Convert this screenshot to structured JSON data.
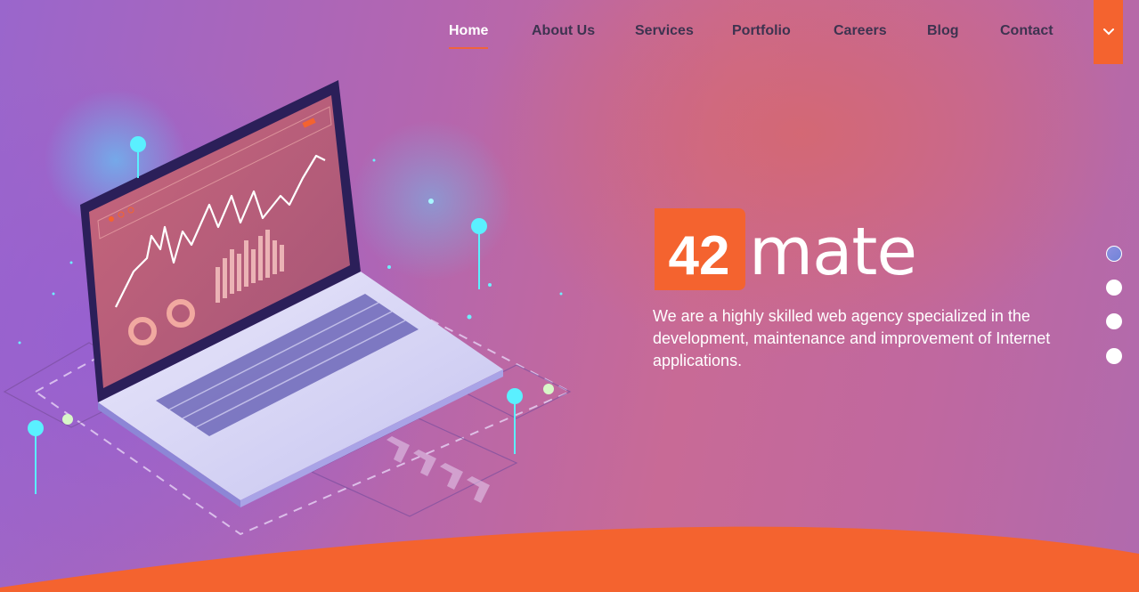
{
  "nav": {
    "items": [
      {
        "label": "Home",
        "active": true
      },
      {
        "label": "About Us",
        "active": false
      },
      {
        "label": "Services",
        "active": false
      },
      {
        "label": "Portfolio",
        "active": false
      },
      {
        "label": "Careers",
        "active": false
      },
      {
        "label": "Blog",
        "active": false
      },
      {
        "label": "Contact",
        "active": false
      }
    ],
    "dropdown_icon": "chevron-down-icon"
  },
  "hero": {
    "logo_number": "42",
    "logo_word": "mate",
    "description": "We are a highly skilled web agency specialized in the development, maintenance and improvement of Internet applications."
  },
  "slider": {
    "dot_count": 4,
    "active_index": 0
  },
  "colors": {
    "accent": "#f4632f",
    "text_white": "#ffffff",
    "nav_text": "#3d3350"
  }
}
